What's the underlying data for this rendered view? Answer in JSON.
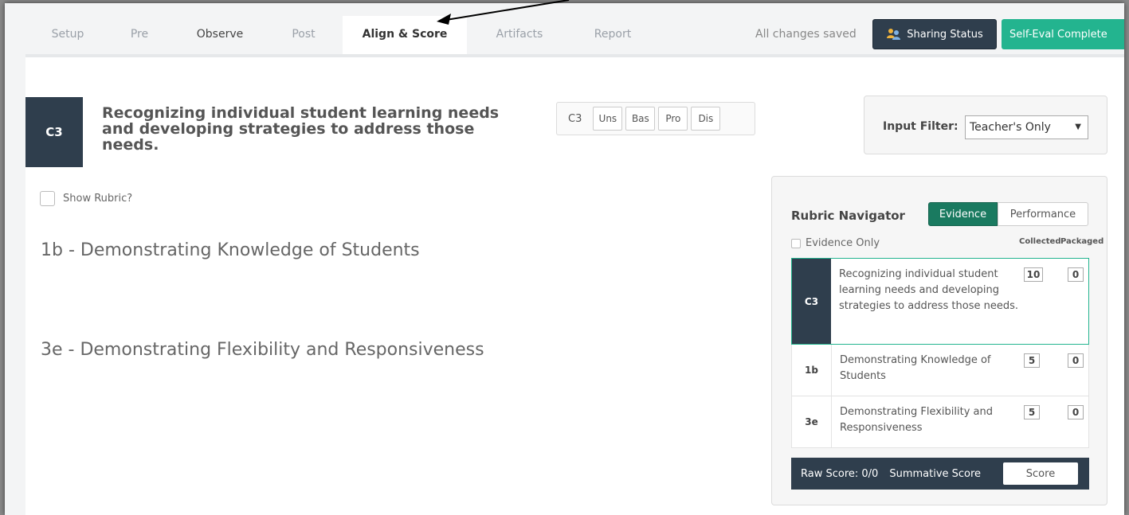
{
  "tabs": [
    {
      "label": "Setup",
      "state": "muted"
    },
    {
      "label": "Pre",
      "state": "muted"
    },
    {
      "label": "Observe",
      "state": "dark"
    },
    {
      "label": "Post",
      "state": "muted"
    },
    {
      "label": "Align & Score",
      "state": "active"
    },
    {
      "label": "Artifacts",
      "state": "muted"
    },
    {
      "label": "Report",
      "state": "muted"
    }
  ],
  "header": {
    "saved_status": "All changes saved",
    "sharing_label": "Sharing Status",
    "self_eval_label": "Self-Eval Complete"
  },
  "component": {
    "code": "C3",
    "title": "Recognizing individual student learning needs and developing strategies to address those needs."
  },
  "score_group": {
    "label": "C3",
    "options": [
      "Uns",
      "Bas",
      "Pro",
      "Dis"
    ]
  },
  "input_filter": {
    "label": "Input Filter:",
    "selected": "Teacher's Only"
  },
  "show_rubric_label": "Show Rubric?",
  "aligned": [
    "1b  -  Demonstrating Knowledge of Students",
    "3e  -  Demonstrating Flexibility and Responsiveness"
  ],
  "navigator": {
    "title": "Rubric Navigator",
    "evidence_label": "Evidence",
    "performance_label": "Performance",
    "evidence_only_label": "Evidence Only",
    "collected_label": "Collected",
    "packaged_label": "Packaged",
    "rows": [
      {
        "code": "C3",
        "desc": "Recognizing individual student learning needs and developing strategies to address those needs.",
        "collected": "10",
        "packaged": "0"
      },
      {
        "code": "1b",
        "desc": "Demonstrating Knowledge of Students",
        "collected": "5",
        "packaged": "0"
      },
      {
        "code": "3e",
        "desc": "Demonstrating Flexibility and Responsiveness",
        "collected": "5",
        "packaged": "0"
      }
    ],
    "raw_score": "Raw Score: 0/0",
    "summative_label": "Summative Score",
    "score_button": "Score"
  },
  "colors": {
    "dark_navy": "#2f3e4d",
    "green": "#23b48f",
    "dark_green": "#1a7a60"
  },
  "icons": [
    "users-icon",
    "checkbox-icon",
    "dropdown-arrow-icon",
    "annotation-arrow-icon"
  ]
}
